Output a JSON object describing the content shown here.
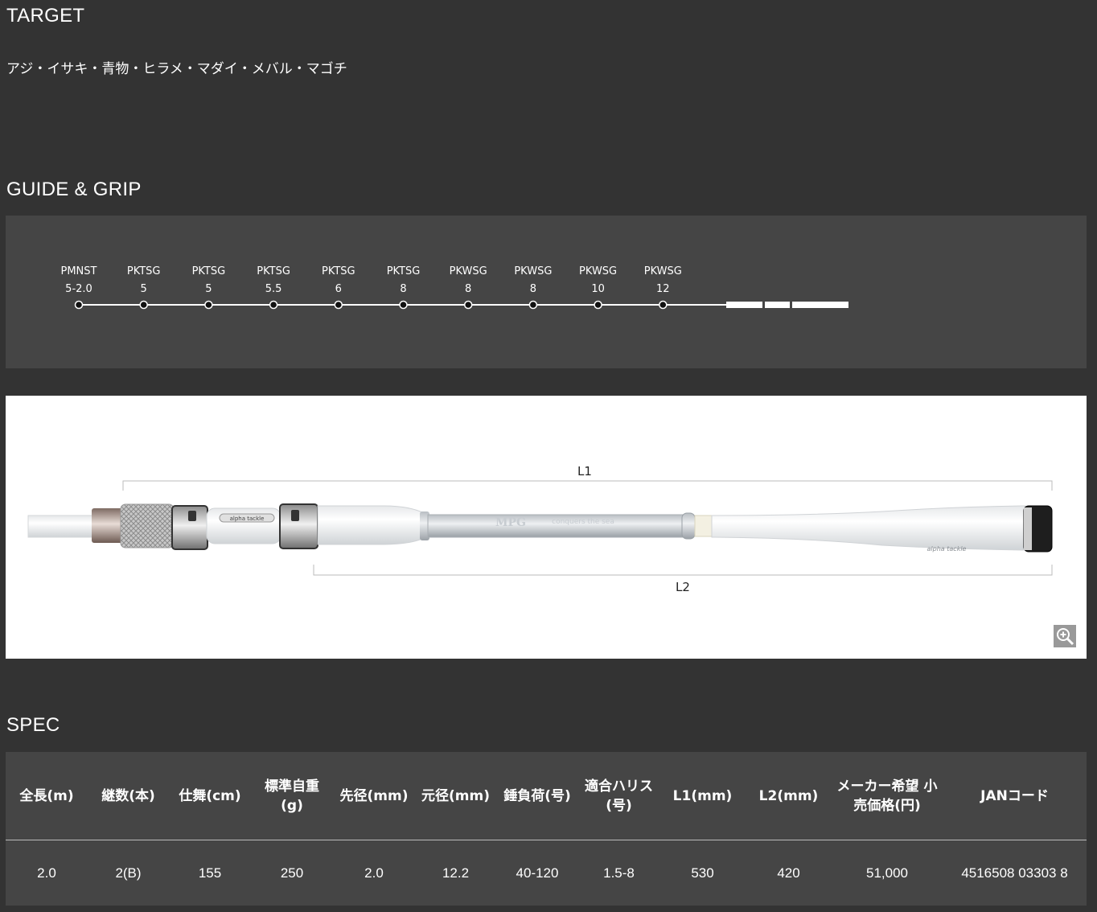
{
  "target": {
    "title": "TARGET",
    "species": "アジ・イサキ・青物・ヒラメ・マダイ・メバル・マゴチ"
  },
  "guide": {
    "title": "GUIDE & GRIP",
    "guides": [
      {
        "name": "PMNST",
        "size": "5-2.0"
      },
      {
        "name": "PKTSG",
        "size": "5"
      },
      {
        "name": "PKTSG",
        "size": "5"
      },
      {
        "name": "PKTSG",
        "size": "5.5"
      },
      {
        "name": "PKTSG",
        "size": "6"
      },
      {
        "name": "PKTSG",
        "size": "8"
      },
      {
        "name": "PKWSG",
        "size": "8"
      },
      {
        "name": "PKWSG",
        "size": "8"
      },
      {
        "name": "PKWSG",
        "size": "10"
      },
      {
        "name": "PKWSG",
        "size": "12"
      }
    ]
  },
  "grip": {
    "l1_label": "L1",
    "l2_label": "L2",
    "blank_text": "MPG",
    "blank_tagline": "conquers the sea",
    "brand": "alpha tackle",
    "zoom_icon": "zoom-in-icon"
  },
  "spec": {
    "title": "SPEC",
    "headers": [
      "全長(m)",
      "継数(本)",
      "仕舞(cm)",
      "標準自重 (g)",
      "先径(mm)",
      "元径(mm)",
      "錘負荷(号)",
      "適合ハリス(号)",
      "L1(mm)",
      "L2(mm)",
      "メーカー希望 小売価格(円)",
      "JANコード"
    ],
    "row": [
      "2.0",
      "2(B)",
      "155",
      "250",
      "2.0",
      "12.2",
      "40-120",
      "1.5-8",
      "530",
      "420",
      "51,000",
      "4516508 03303 8"
    ]
  }
}
